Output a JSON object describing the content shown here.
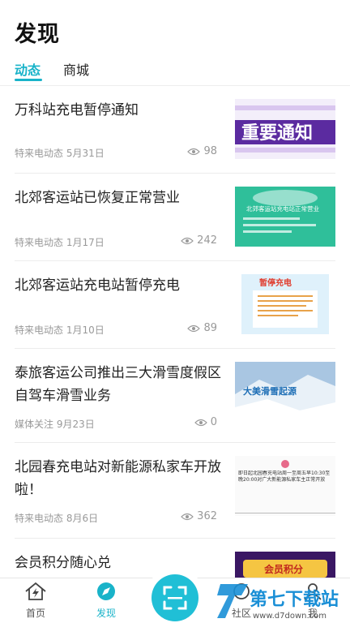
{
  "header": {
    "title": "发现"
  },
  "tabs": [
    {
      "label": "动态",
      "active": true
    },
    {
      "label": "商城",
      "active": false
    }
  ],
  "feed": [
    {
      "title": "万科站充电暂停通知",
      "source": "特来电动态",
      "date": "5月31日",
      "views": "98",
      "thumb_text": "重要通知"
    },
    {
      "title": "北郊客运站已恢复正常营业",
      "source": "特来电动态",
      "date": "1月17日",
      "views": "242",
      "thumb_text": "北郊客运站充电站正常营业"
    },
    {
      "title": "北郊客运站充电站暂停充电",
      "source": "特来电动态",
      "date": "1月10日",
      "views": "89",
      "thumb_text": "暂停充电"
    },
    {
      "title": "泰旅客运公司推出三大滑雪度假区自驾车滑雪业务",
      "source": "媒体关注",
      "date": "9月23日",
      "views": "0",
      "thumb_text": "大美滑雪起源"
    },
    {
      "title": "北园春充电站对新能源私家车开放啦！",
      "source": "特来电动态",
      "date": "8月6日",
      "views": "362",
      "thumb_text": "即日起北园春充电站周一至周五早10:30至晚20:00对广大新能源私家车主正常开放"
    },
    {
      "title": "会员积分随心兑",
      "source": "",
      "date": "",
      "views": "",
      "thumb_text": "会员积分"
    }
  ],
  "nav": {
    "home": "首页",
    "discover": "发现",
    "community": "社区",
    "me": "我"
  },
  "watermark": {
    "text": "第七下载站",
    "url": "www.d7down.com"
  },
  "colors": {
    "accent": "#19b3c9",
    "scan": "#20bfd6"
  }
}
